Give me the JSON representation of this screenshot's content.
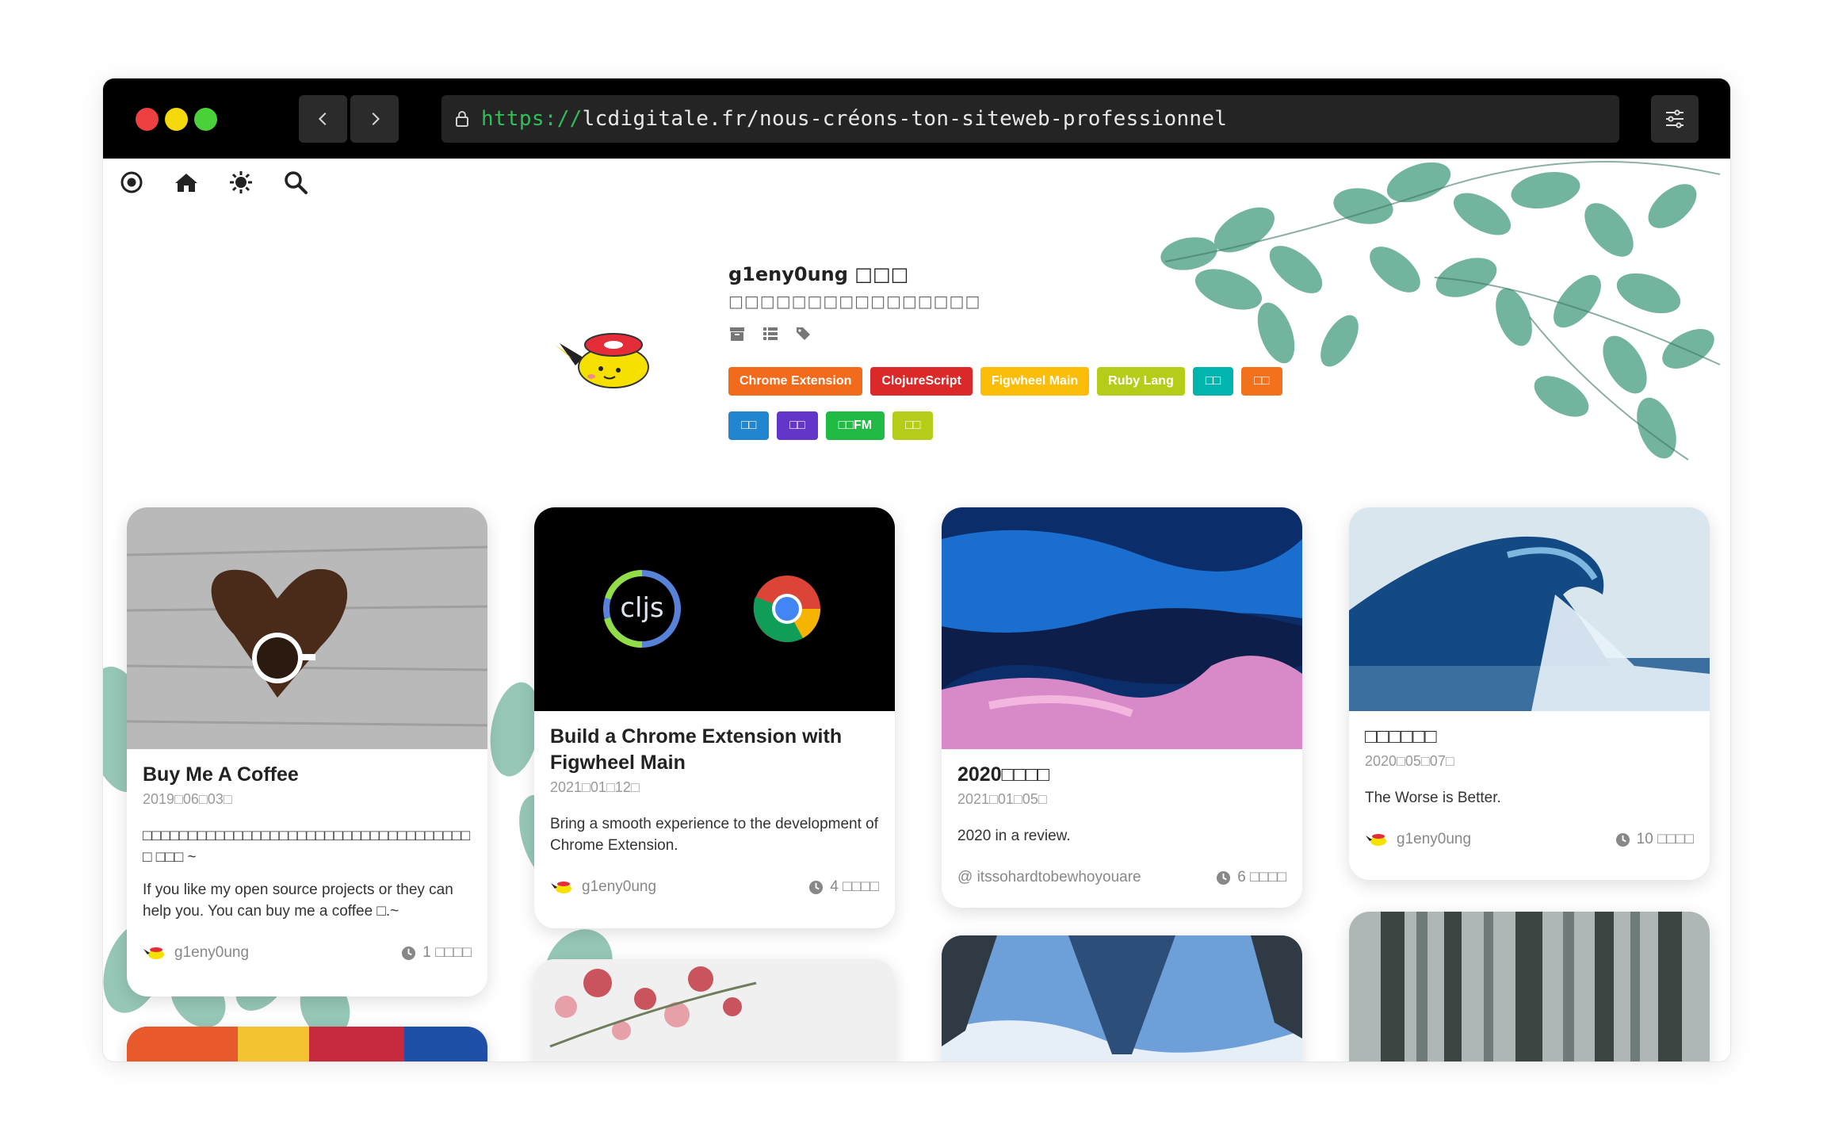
{
  "browser": {
    "url_scheme": "https://",
    "url_rest": "lcdigitale.fr/nous-créons-ton-siteweb-professionnel",
    "dot_colors": [
      "#ee4040",
      "#f5d90a",
      "#4bd13a"
    ]
  },
  "topnav": {
    "icons": [
      "target-icon",
      "home-icon",
      "sun-icon",
      "search-icon"
    ]
  },
  "profile": {
    "name": "g1eny0ung □□□",
    "description": "□□□□□□□□□□□□□□□□",
    "icons": [
      "archive-icon",
      "list-icon",
      "tags-icon"
    ]
  },
  "tags": {
    "row1": [
      {
        "label": "Chrome Extension",
        "color": "#f26b1d"
      },
      {
        "label": "ClojureScript",
        "color": "#db2828"
      },
      {
        "label": "Figwheel Main",
        "color": "#fbbd08"
      },
      {
        "label": "Ruby Lang",
        "color": "#b5cc18"
      },
      {
        "label": "□□",
        "color": "#00b5ad"
      },
      {
        "label": "□□",
        "color": "#f2711c"
      }
    ],
    "row2": [
      {
        "label": "□□",
        "color": "#2185d0"
      },
      {
        "label": "□□",
        "color": "#6435c9"
      },
      {
        "label": "□□FM",
        "color": "#21ba45"
      },
      {
        "label": "□□",
        "color": "#b5cc18"
      }
    ]
  },
  "cards": {
    "c1": {
      "title": "Buy Me A Coffee",
      "date": "2019□06□03□",
      "summary_zh": "□□□□□□□□□□□□□□□□□□□□□□□□□□□□□□□□□□□□ □ □□□ ~",
      "summary_en": "If you like my open source projects or they can help you. You can buy me a coffee □.~",
      "author": "g1eny0ung",
      "read": "1 □□□□"
    },
    "c2": {
      "title": "Build a Chrome Extension with Figwheel Main",
      "date": "2021□01□12□",
      "summary": "Bring a smooth experience to the development of Chrome Extension.",
      "author": "g1eny0ung",
      "read": "4 □□□□",
      "cljs": "cljs"
    },
    "c3": {
      "title": "2020□□□□",
      "date": "2021□01□05□",
      "summary": "2020 in a review.",
      "author": "@ itssohardtobewhoyouare",
      "read": "6 □□□□"
    },
    "c4": {
      "title": "□□□□□□",
      "date": "2020□05□07□",
      "summary": "The Worse is Better.",
      "author": "g1eny0ung",
      "read": "10 □□□□"
    }
  }
}
